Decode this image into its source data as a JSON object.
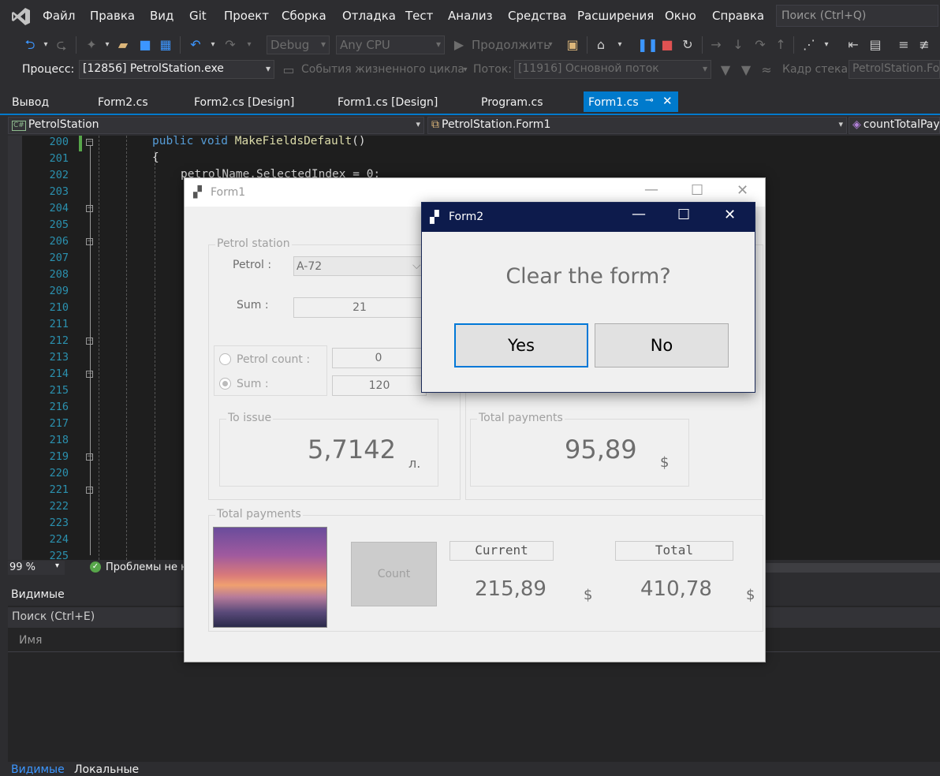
{
  "menu": {
    "items": [
      "Файл",
      "Правка",
      "Вид",
      "Git",
      "Проект",
      "Сборка",
      "Отладка",
      "Тест",
      "Анализ",
      "Средства",
      "Расширения",
      "Окно",
      "Справка"
    ],
    "search_placeholder": "Поиск (Ctrl+Q)"
  },
  "toolbar": {
    "config": "Debug",
    "platform": "Any CPU",
    "continue_label": "Продолжить"
  },
  "debug_bar": {
    "process_label": "Процесс:",
    "process_value": "[12856] PetrolStation.exe",
    "lifecycle_label": "События жизненного цикла",
    "thread_label": "Поток:",
    "thread_value": "[11916] Основной поток",
    "stack_label": "Кадр стека:",
    "stack_value": "PetrolStation.Form"
  },
  "tabs": [
    "Вывод",
    "Form2.cs",
    "Form2.cs [Design]",
    "Form1.cs [Design]",
    "Program.cs"
  ],
  "active_tab": "Form1.cs",
  "nav": {
    "project": "PetrolStation",
    "class": "PetrolStation.Form1",
    "member": "countTotalPay"
  },
  "editor": {
    "line_numbers": [
      "200",
      "201",
      "202",
      "203",
      "204",
      "205",
      "206",
      "207",
      "208",
      "209",
      "210",
      "211",
      "212",
      "213",
      "214",
      "215",
      "216",
      "217",
      "218",
      "219",
      "220",
      "221",
      "222",
      "223",
      "224",
      "225"
    ],
    "line1_kw": "public void ",
    "line1_fn": "MakeFieldsDefault",
    "line1_rest": "()",
    "line2": "{",
    "line3": "petrolName.SelectedIndex = 0;"
  },
  "status": {
    "zoom": "99 %",
    "problems": "Проблемы не н"
  },
  "bottom": {
    "title": "Видимые",
    "search_placeholder": "Поиск (Ctrl+E)",
    "col_name": "Имя",
    "tab_visible": "Видимые",
    "tab_locals": "Локальные"
  },
  "form1": {
    "title": "Form1",
    "petrol_station": {
      "group_label": "Petrol station",
      "petrol_label": "Petrol :",
      "petrol_value": "A-72",
      "sum_label": "Sum :",
      "sum_value": "21",
      "radio_count_label": "Petrol count :",
      "radio_count_value": "0",
      "radio_sum_label": "Sum :",
      "radio_sum_value": "120"
    },
    "to_issue": {
      "group_label": "To issue",
      "value": "5,7142",
      "unit": "л."
    },
    "total_payments_inner": {
      "group_label": "Total payments",
      "value": "95,89",
      "unit": "$"
    },
    "total_payments": {
      "group_label": "Total payments",
      "count_button": "Count",
      "current_label": "Current",
      "current_value": "215,89",
      "current_unit": "$",
      "total_label": "Total",
      "total_value": "410,78",
      "total_unit": "$"
    }
  },
  "form2": {
    "title": "Form2",
    "question": "Clear the form?",
    "yes": "Yes",
    "no": "No"
  }
}
